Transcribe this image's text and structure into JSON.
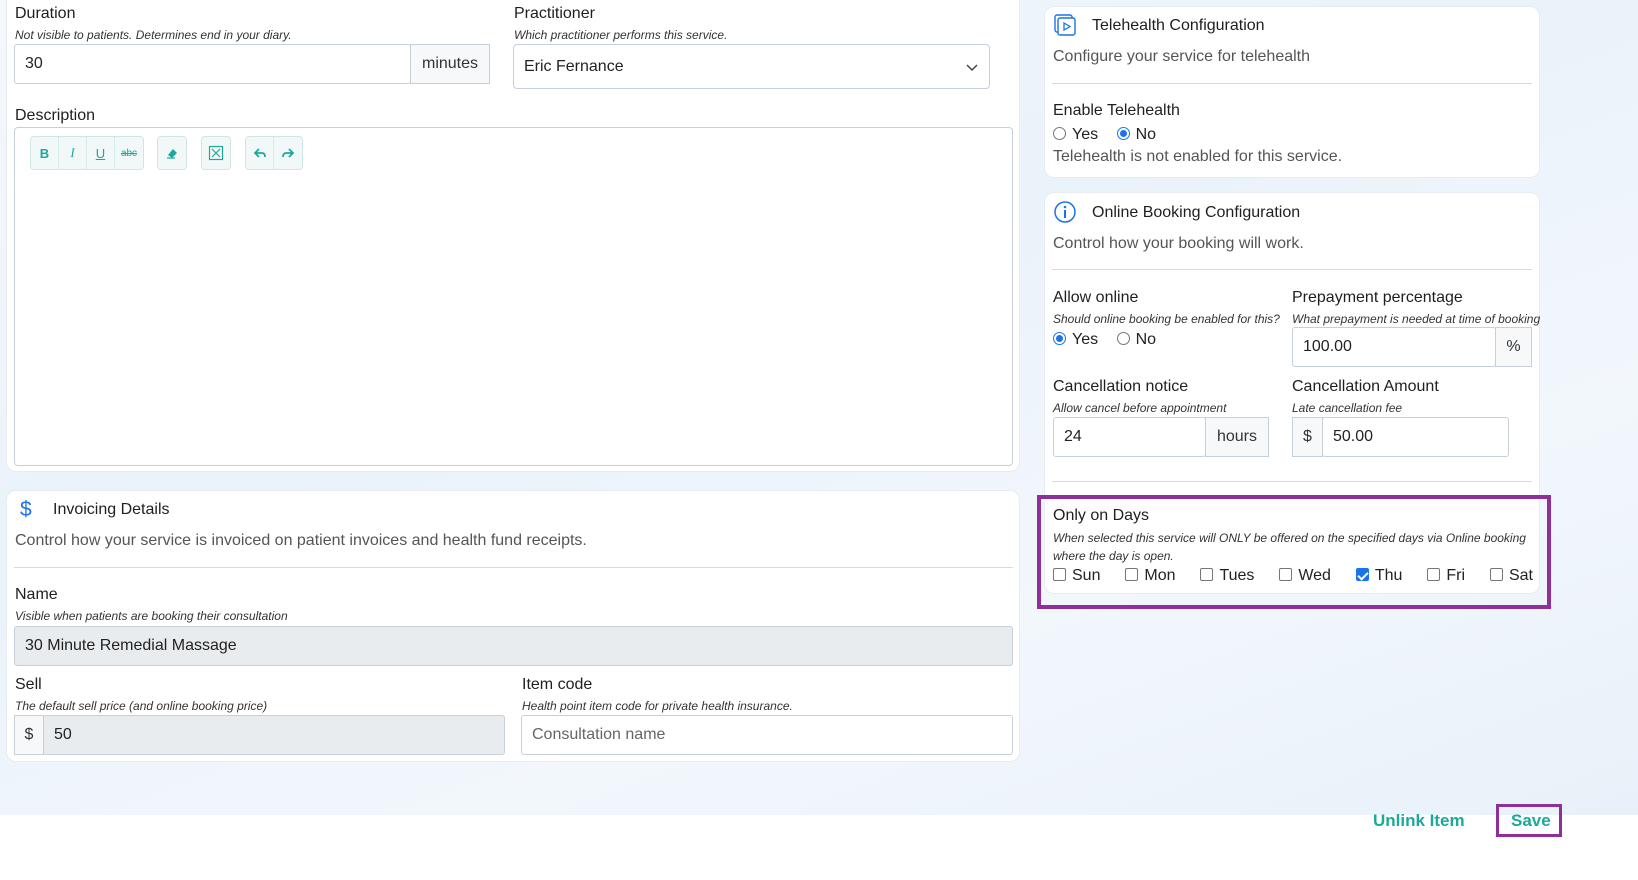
{
  "duration": {
    "label": "Duration",
    "hint": "Not visible to patients. Determines end in your diary.",
    "value": "30",
    "unit": "minutes"
  },
  "practitioner": {
    "label": "Practitioner",
    "hint": "Which practitioner performs this service.",
    "value": "Eric Fernance"
  },
  "description": {
    "label": "Description",
    "toolbar": {
      "bold": "B",
      "italic": "I",
      "underline": "U",
      "strike": "abc"
    }
  },
  "invoicing": {
    "title": "Invoicing Details",
    "icon_glyph": "$",
    "subtitle": "Control how your service is invoiced on patient invoices and health fund receipts.",
    "name_label": "Name",
    "name_hint": "Visible when patients are booking their consultation",
    "name_value": "30 Minute Remedial Massage",
    "sell_label": "Sell",
    "sell_hint": "The default sell price (and online booking price)",
    "sell_prefix": "$",
    "sell_value": "50",
    "item_code_label": "Item code",
    "item_code_hint": "Health point item code for private health insurance.",
    "item_code_placeholder": "Consultation name"
  },
  "telehealth": {
    "title": "Telehealth Configuration",
    "subtitle": "Configure your service for telehealth",
    "enable_label": "Enable Telehealth",
    "yes": "Yes",
    "no": "No",
    "status": "Telehealth is not enabled for this service."
  },
  "online_booking": {
    "title": "Online Booking Configuration",
    "subtitle": "Control how your booking will work.",
    "allow_label": "Allow online",
    "allow_hint": "Should online booking be enabled for this?",
    "yes": "Yes",
    "no": "No",
    "prepay_label": "Prepayment percentage",
    "prepay_hint": "What prepayment is needed at time of booking",
    "prepay_value": "100.00",
    "prepay_suffix": "%",
    "cancel_notice_label": "Cancellation notice",
    "cancel_notice_hint": "Allow cancel before appointment",
    "cancel_notice_value": "24",
    "cancel_notice_unit": "hours",
    "cancel_amount_label": "Cancellation Amount",
    "cancel_amount_hint": "Late cancellation fee",
    "cancel_amount_prefix": "$",
    "cancel_amount_value": "50.00"
  },
  "only_days": {
    "label": "Only on Days",
    "hint": "When selected this service will ONLY be offered on the specified days via Online booking where the day is open.",
    "days": [
      {
        "label": "Sun",
        "checked": false
      },
      {
        "label": "Mon",
        "checked": false
      },
      {
        "label": "Tues",
        "checked": false
      },
      {
        "label": "Wed",
        "checked": false
      },
      {
        "label": "Thu",
        "checked": true
      },
      {
        "label": "Fri",
        "checked": false
      },
      {
        "label": "Sat",
        "checked": false
      }
    ]
  },
  "footer": {
    "unlink_label": "Unlink Item",
    "save_label": "Save"
  },
  "colors": {
    "accent": "#1aa99a",
    "highlight": "#8e2f9a",
    "radio_blue": "#1a73e8"
  }
}
